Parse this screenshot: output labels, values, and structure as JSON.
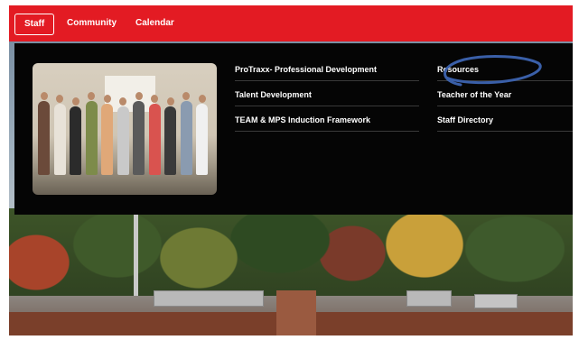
{
  "nav": {
    "items": [
      {
        "label": "Staff",
        "active": true
      },
      {
        "label": "Community"
      },
      {
        "label": "Calendar"
      }
    ]
  },
  "mega_menu": {
    "photo_alt": "Group photo of staff members",
    "column_1": [
      {
        "label": "ProTraxx- Professional Development"
      },
      {
        "label": "Talent Development"
      },
      {
        "label": "TEAM & MPS Induction Framework"
      }
    ],
    "column_2": [
      {
        "label": "Resources"
      },
      {
        "label": "Teacher of the  Year"
      },
      {
        "label": "Staff Directory"
      }
    ]
  },
  "colors": {
    "nav_bg": "#e31b23",
    "menu_bg": "#050505",
    "annotation_stroke": "#3a5fa8"
  }
}
